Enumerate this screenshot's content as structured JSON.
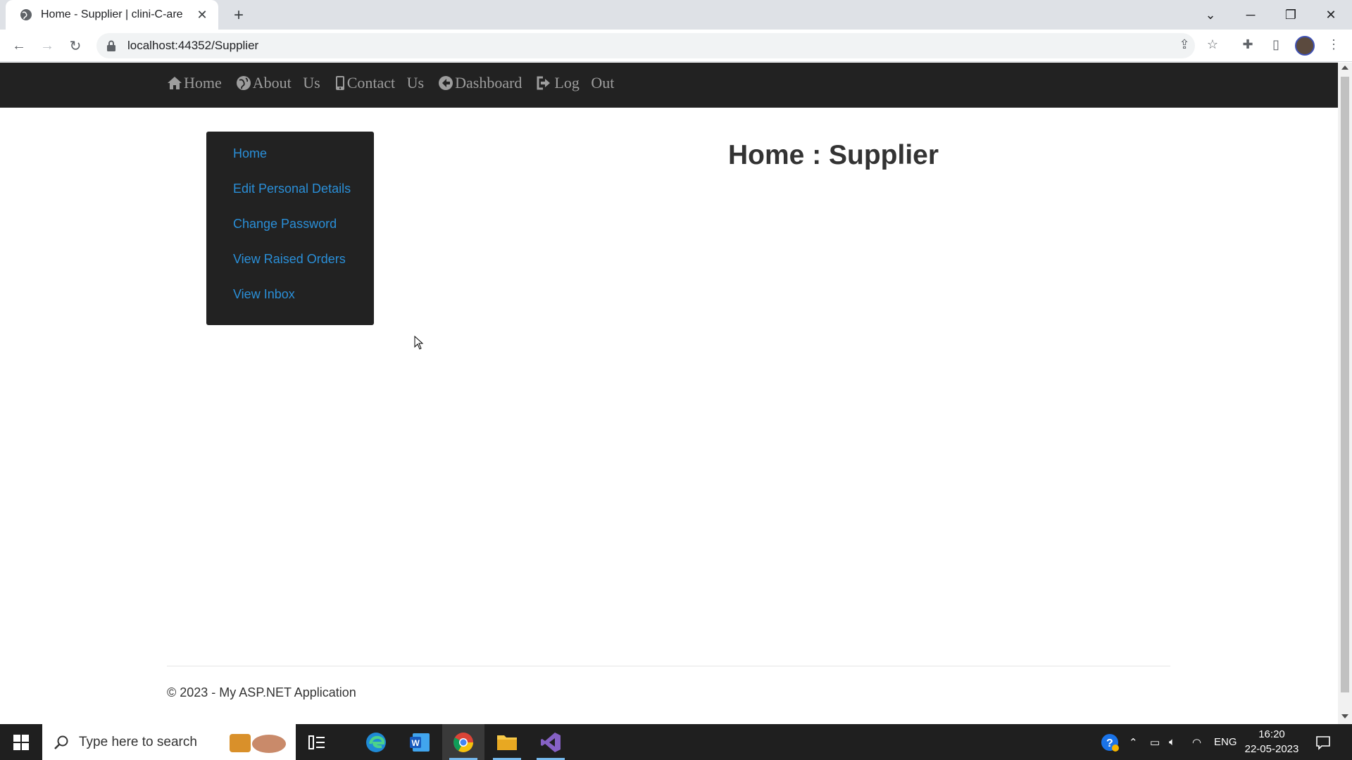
{
  "browser": {
    "tab_title": "Home - Supplier | clini-C-are",
    "url": "localhost:44352/Supplier"
  },
  "navbar": {
    "links": [
      {
        "label": "Home",
        "icon": "home-icon"
      },
      {
        "label": "About   Us",
        "icon": "globe-icon"
      },
      {
        "label": "Contact   Us",
        "icon": "phone-icon"
      },
      {
        "label": "Dashboard",
        "icon": "circle-arrow-left-icon"
      },
      {
        "label": "Log   Out",
        "icon": "logout-icon"
      }
    ]
  },
  "sidebar": {
    "items": [
      {
        "label": "Home"
      },
      {
        "label": "Edit Personal Details"
      },
      {
        "label": "Change Password"
      },
      {
        "label": "View Raised Orders"
      },
      {
        "label": "View Inbox"
      }
    ]
  },
  "main": {
    "title": "Home : Supplier"
  },
  "footer": {
    "text": "© 2023 - My ASP.NET Application"
  },
  "taskbar": {
    "search_placeholder": "Type here to search",
    "language": "ENG",
    "time": "16:20",
    "date": "22-05-2023"
  },
  "colors": {
    "navbar_bg": "#222222",
    "sidebar_link": "#2a8fd8",
    "nav_link": "#9d9d9d"
  }
}
